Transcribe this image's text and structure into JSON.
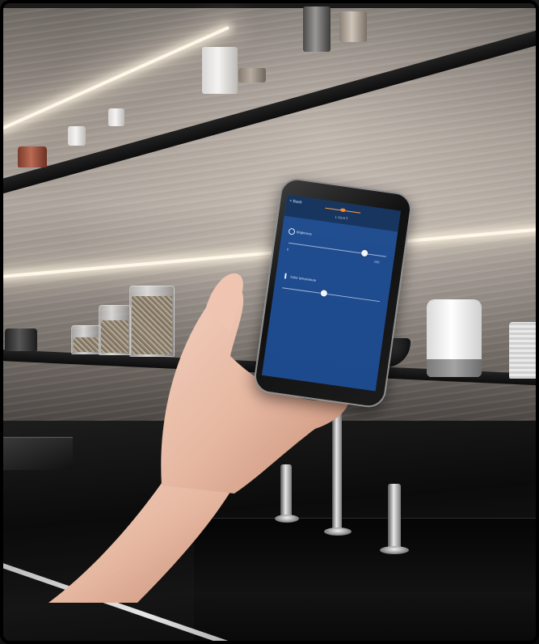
{
  "app": {
    "back_label": "< Back",
    "title": "LIGHT",
    "brightness_label": "Brightness",
    "brightness_min": "0",
    "brightness_max": "100",
    "brightness_level": 0.78,
    "temperature_label": "Color temperature",
    "temperature_level": 0.43,
    "icons": [
      "sun-icon",
      "thermometer-icon"
    ],
    "accent_color": "#ff8a2a",
    "screen_color": "#1f4c8f"
  }
}
